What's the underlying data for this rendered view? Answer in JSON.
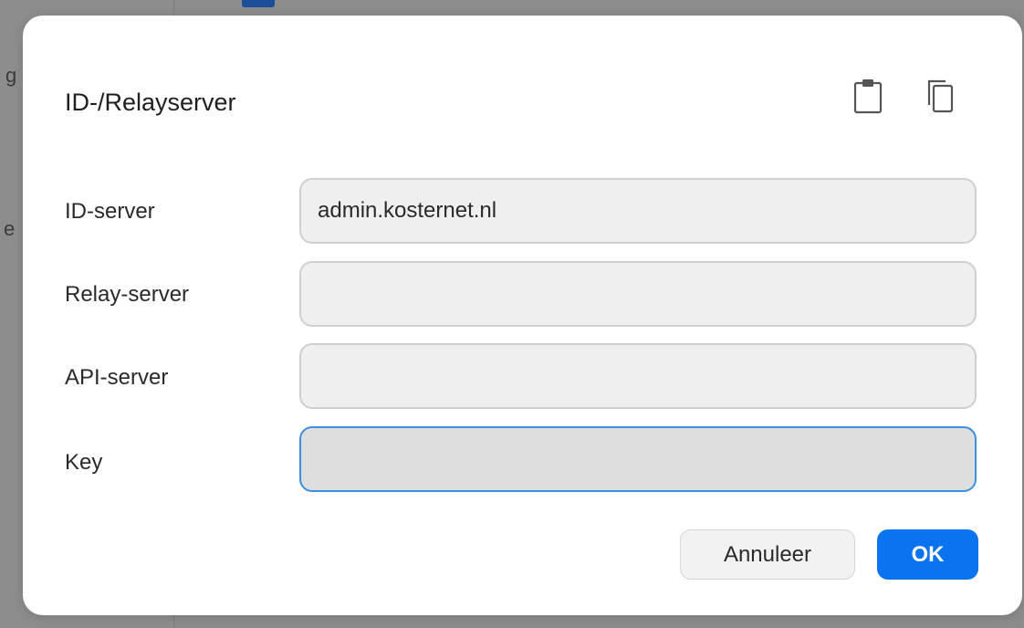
{
  "background": {
    "left_text_1": "g",
    "left_text_2": "e"
  },
  "dialog": {
    "title": "ID-/Relayserver",
    "paste_icon": "clipboard-icon",
    "copy_icon": "copy-icon",
    "fields": [
      {
        "label": "ID-server",
        "value": "admin.kosternet.nl",
        "placeholder": ""
      },
      {
        "label": "Relay-server",
        "value": "",
        "placeholder": ""
      },
      {
        "label": "API-server",
        "value": "",
        "placeholder": ""
      },
      {
        "label": "Key",
        "value": "",
        "placeholder": ""
      }
    ],
    "cancel_label": "Annuleer",
    "ok_label": "OK"
  },
  "colors": {
    "accent": "#0a74f0",
    "focus_border": "#3b8fde",
    "field_bg": "#efefef"
  }
}
